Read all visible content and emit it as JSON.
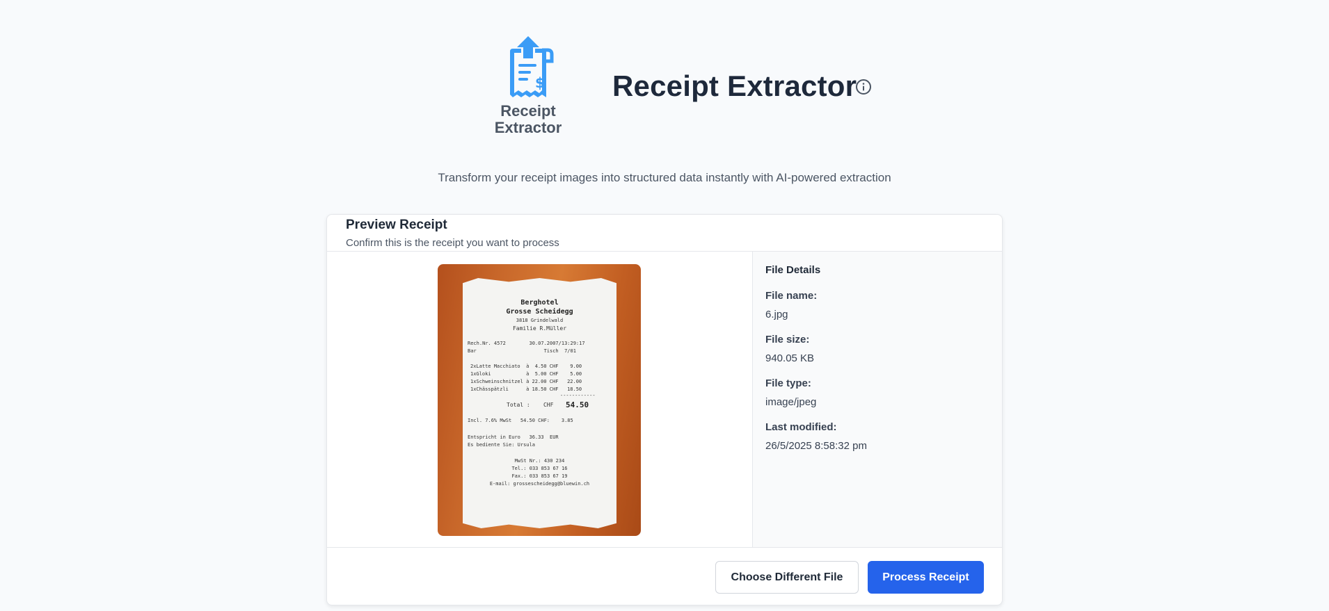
{
  "app": {
    "logo_text_line1": "Receipt",
    "logo_text_line2": "Extractor",
    "title": "Receipt Extractor",
    "subtitle": "Transform your receipt images into structured data instantly with AI-powered extraction"
  },
  "preview": {
    "title": "Preview Receipt",
    "description": "Confirm this is the receipt you want to process",
    "receipt_lines": [
      "Berghotel",
      "Grosse Scheidegg",
      "3818 Grindelwald",
      "Familie R.Müller",
      "Rech.Nr. 4572        30.07.2007/13:29:17",
      "Bar                       Tisch  7/01",
      "2xLatte Macchiato  à  4.50 CHF    9.00",
      "1xGloki            à  5.00 CHF    5.00",
      "1xSchweinschnitzel à 22.00 CHF   22.00",
      "1xChässpätzli      à 18.50 CHF   18.50",
      "------------",
      "Total :    CHF",
      "54.50",
      "Incl. 7.6% MwSt   54.50 CHF:    3.85",
      "Entspricht in Euro   36.33  EUR",
      "Es bediente Sie: Ursula",
      "MwSt Nr.: 430 234",
      "Tel.: 033 853 67 16",
      "Fax.: 033 853 67 19",
      "E-mail: grossescheidegg@bluewin.ch"
    ]
  },
  "details": {
    "title": "File Details",
    "file_name_label": "File name:",
    "file_name": "6.jpg",
    "file_size_label": "File size:",
    "file_size": "940.05 KB",
    "file_type_label": "File type:",
    "file_type": "image/jpeg",
    "last_modified_label": "Last modified:",
    "last_modified": "26/5/2025 8:58:32 pm"
  },
  "actions": {
    "choose_label": "Choose Different File",
    "process_label": "Process Receipt"
  },
  "colors": {
    "accent": "#2563eb",
    "logo_blue": "#3b9cf6",
    "background": "#f8fafc"
  }
}
